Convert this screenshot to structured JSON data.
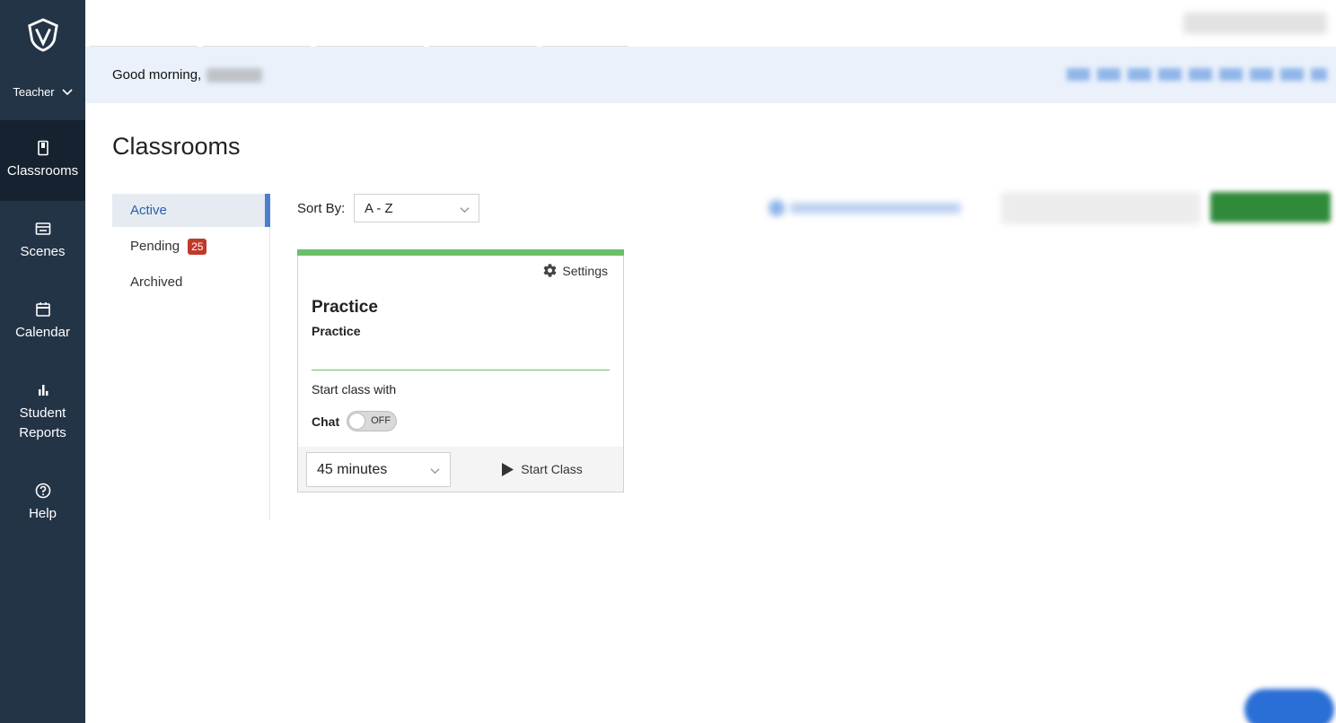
{
  "sidebar": {
    "role": "Teacher",
    "items": [
      {
        "label": "Classrooms",
        "icon": "book-icon",
        "active": true
      },
      {
        "label": "Scenes",
        "icon": "scenes-icon",
        "active": false
      },
      {
        "label": "Calendar",
        "icon": "calendar-icon",
        "active": false
      },
      {
        "label": "Student Reports",
        "icon": "bar-chart-icon",
        "active": false
      },
      {
        "label": "Help",
        "icon": "help-icon",
        "active": false
      }
    ]
  },
  "greeting": {
    "prefix": "Good morning,"
  },
  "page": {
    "title": "Classrooms"
  },
  "subnav": {
    "items": [
      {
        "label": "Active",
        "active": true
      },
      {
        "label": "Pending",
        "badge": "25"
      },
      {
        "label": "Archived"
      }
    ]
  },
  "sort": {
    "label": "Sort By:",
    "value": "A - Z"
  },
  "card": {
    "settings_label": "Settings",
    "title": "Practice",
    "subtitle": "Practice",
    "start_with_label": "Start class with",
    "chat_label": "Chat",
    "chat_toggle": "OFF",
    "duration": "45 minutes",
    "start_label": "Start Class"
  },
  "colors": {
    "sidebar_bg": "#243447",
    "sidebar_active_bg": "#16222f",
    "accent_blue": "#4a7fd0",
    "card_green": "#6abf69",
    "badge_red": "#c0392b"
  }
}
